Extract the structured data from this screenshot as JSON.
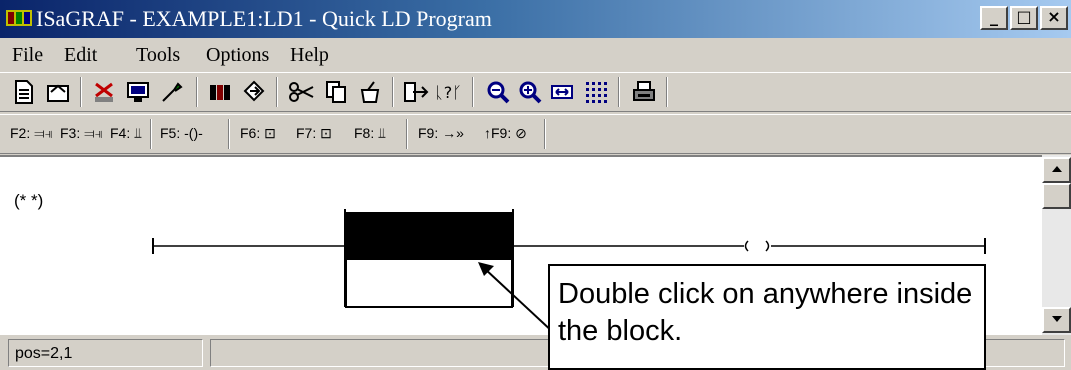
{
  "window": {
    "title": "ISaGRAF - EXAMPLE1:LD1 - Quick LD Program",
    "controls": {
      "minimize": "_",
      "maximize": "□",
      "close": "×"
    }
  },
  "menu": [
    {
      "label": "File"
    },
    {
      "label": "Edit"
    },
    {
      "label": "Tools"
    },
    {
      "label": "Options"
    },
    {
      "label": "Help"
    }
  ],
  "toolbar1": [
    "new-document-icon",
    "open-icon",
    "cut-variables-icon",
    "dictionary-icon",
    "tools-icon",
    "library-icon",
    "compile-icon",
    "scissors-icon",
    "copy-icon",
    "paste-icon",
    "insert-icon",
    "comment-icon",
    "zoom-out-icon",
    "zoom-in-icon",
    "fit-icon",
    "grid-icon",
    "print-icon"
  ],
  "toolbar2": {
    "f2": "F2:",
    "f3": "F3:",
    "f4": "F4:",
    "f5": "F5:",
    "f6": "F6:",
    "f7": "F7:",
    "f8": "F8:",
    "f9": "F9:",
    "sf9": "↑F9:"
  },
  "editor": {
    "comment": "(* *)"
  },
  "status": {
    "pos": "pos=2,1"
  },
  "callout": {
    "text": "Double click on anywhere inside the block."
  }
}
